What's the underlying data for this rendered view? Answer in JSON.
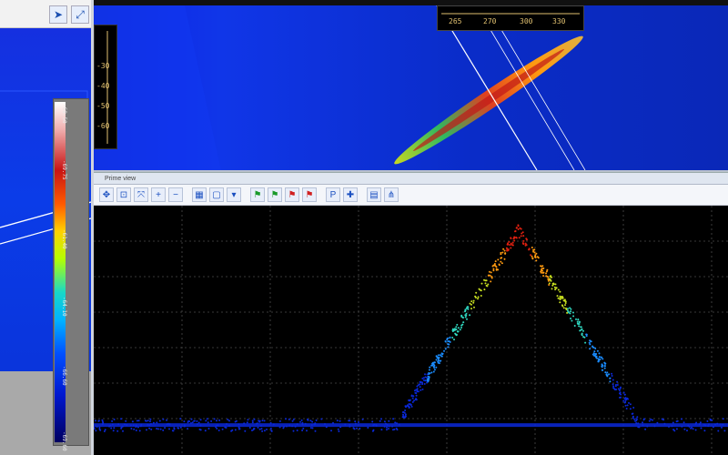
{
  "left_panel": {
    "toolbar_icons": [
      "pointer-icon",
      "resize-icon"
    ],
    "colorbar": {
      "labels": [
        "-68.50",
        "-69.75",
        "-61.40",
        "-64.10",
        "-66.60",
        "-69.60"
      ],
      "colors": [
        "#ffffff",
        "#c81414",
        "#ffd000",
        "#18d8c8",
        "#0050ff",
        "#000060"
      ]
    }
  },
  "top_view": {
    "scale_horizontal": {
      "labels": [
        "265",
        "270",
        "300",
        "330"
      ]
    },
    "scale_vertical": {
      "labels": [
        "-30",
        "-40",
        "-50",
        "-60"
      ]
    }
  },
  "profile_panel": {
    "title": "Prime view",
    "toolbar_icons": [
      "select-icon",
      "zoom-box-icon",
      "fit-icon",
      "zoom-in-icon",
      "zoom-out-icon",
      "grid-icon",
      "frame-icon",
      "range-dropdown-icon",
      "flag-green-icon",
      "flag-green-2-icon",
      "flag-red-icon",
      "flag-red-2-icon",
      "probe-icon",
      "add-icon",
      "report-icon",
      "split-icon"
    ]
  },
  "chart_data": {
    "type": "scatter",
    "title": "",
    "xlabel": "",
    "ylabel": "",
    "grid": true,
    "description_series": [
      {
        "name": "",
        "shape": "cone-profile",
        "peak_x": 0.67,
        "peak_height": 0.78,
        "base_height": 0.1
      }
    ]
  },
  "colors": {
    "background_blue": "#0a2fe0",
    "profile_bg": "#000000",
    "grid_line": "#4a4a4a"
  }
}
